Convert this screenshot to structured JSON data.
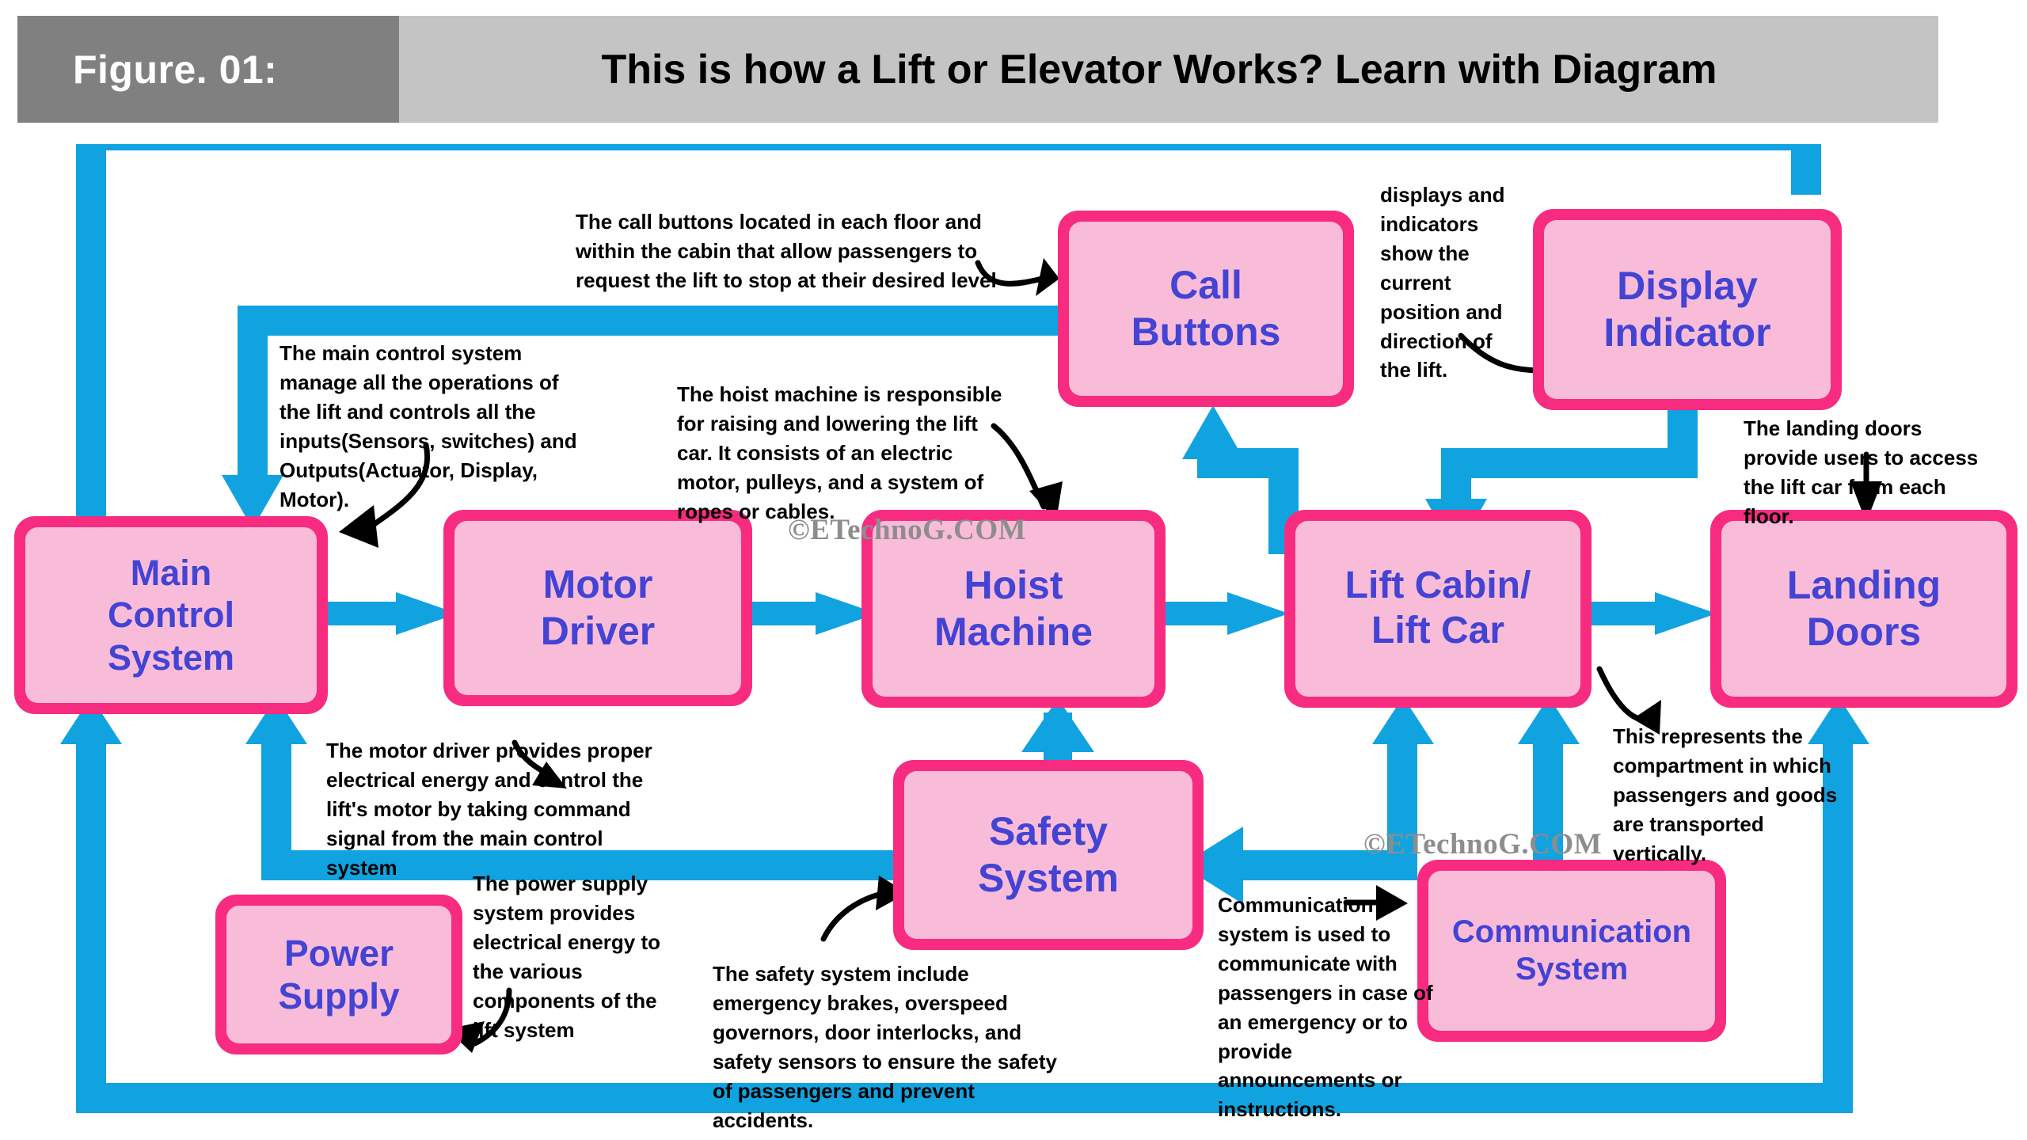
{
  "header": {
    "figure_tag": "Figure. 01:",
    "title": "This is how a Lift or Elevator Works? Learn with Diagram"
  },
  "watermark": {
    "text": "©ETechnoG.COM"
  },
  "colors": {
    "node_border": "#f72c80",
    "node_fill": "#f9bcd8",
    "node_text": "#4343d4",
    "arrow": "#11a3e0",
    "header_tag_bg": "#808080",
    "header_title_bg": "#c4c4c4",
    "annotation_text": "#000000",
    "watermark_text": "#8d8d8d"
  },
  "nodes": [
    {
      "id": "main-control-system",
      "lines": [
        "Main",
        "Control",
        "System"
      ]
    },
    {
      "id": "motor-driver",
      "lines": [
        "Motor",
        "Driver"
      ]
    },
    {
      "id": "hoist-machine",
      "lines": [
        "Hoist",
        "Machine"
      ]
    },
    {
      "id": "lift-cabin",
      "lines": [
        "Lift Cabin/",
        "Lift Car"
      ]
    },
    {
      "id": "landing-doors",
      "lines": [
        "Landing",
        "Doors"
      ]
    },
    {
      "id": "call-buttons",
      "lines": [
        "Call",
        "Buttons"
      ]
    },
    {
      "id": "display-indicator",
      "lines": [
        "Display",
        "Indicator"
      ]
    },
    {
      "id": "safety-system",
      "lines": [
        "Safety",
        "System"
      ]
    },
    {
      "id": "power-supply",
      "lines": [
        "Power",
        "Supply"
      ]
    },
    {
      "id": "communication-system",
      "lines": [
        "Communication",
        "System"
      ]
    }
  ],
  "annotations": {
    "call_buttons": "The call buttons located in each floor and within the cabin that allow passengers to request the lift to stop at their desired level",
    "main_control": "The main control system manage all the operations of the lift  and controls all the inputs(Sensors, switches) and Outputs(Actuator, Display, Motor).",
    "hoist_machine": "The hoist machine is responsible for raising and lowering the lift car. It consists of an electric motor, pulleys, and a system of ropes or cables.",
    "display_indicator": "displays and indicators show the current position and direction of the lift.",
    "landing_doors": "The landing doors provide users to access the lift car from each floor.",
    "motor_driver": "The motor driver provides proper electrical energy and control the lift's motor by taking command signal from the main control system",
    "power_supply": "The power supply system provides electrical energy to the various components of the lift system",
    "safety_system": "The safety system include emergency brakes, overspeed governors, door interlocks, and safety sensors to ensure the safety of passengers and prevent accidents.",
    "lift_cabin": "This represents the compartment in which passengers and goods are transported vertically.",
    "communication_system": "Communication system is used to communicate with passengers in case of an emergency or to provide announcements or instructions."
  }
}
